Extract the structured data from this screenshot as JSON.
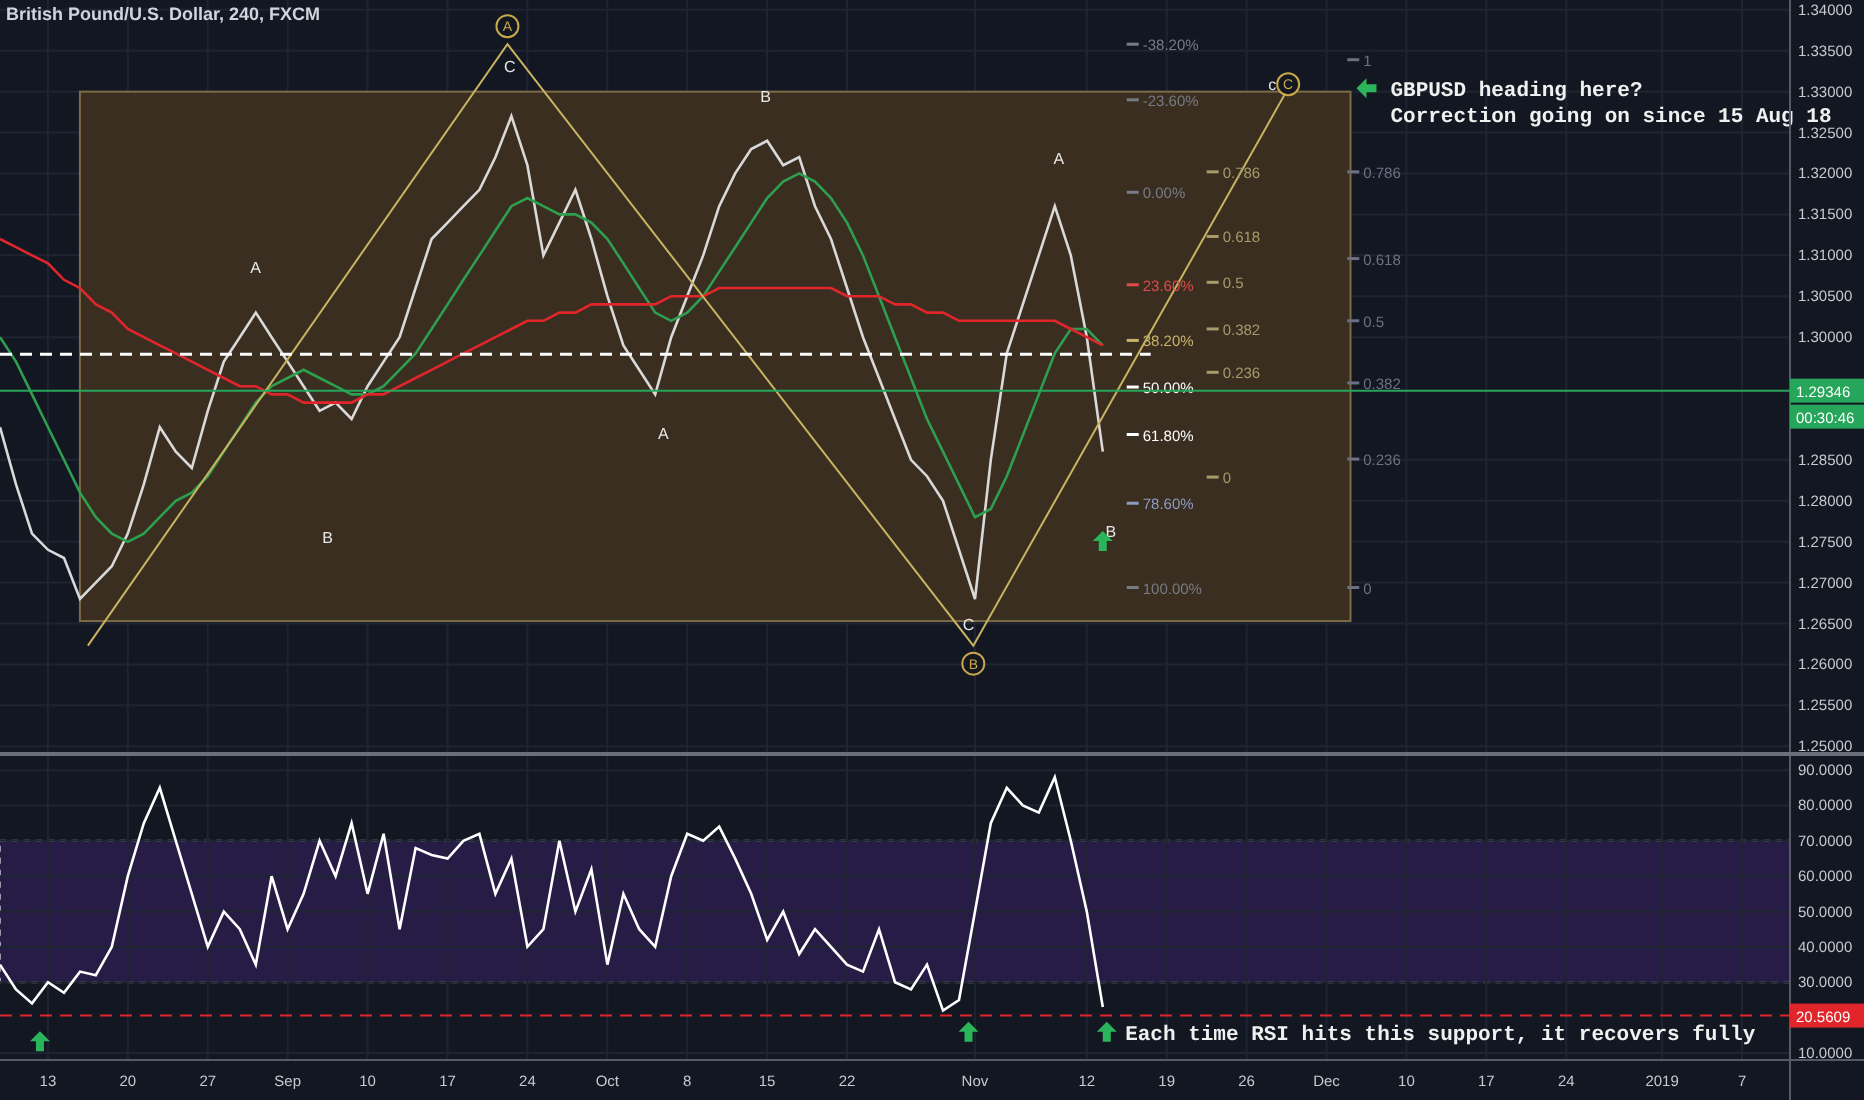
{
  "title": "British Pound/U.S. Dollar, 240, FXCM",
  "price_pane": {
    "chart_data": {
      "type": "line",
      "grid": true,
      "series": [
        {
          "color": "#d9d9d9",
          "values": [
            1.289,
            1.282,
            1.276,
            1.274,
            1.273,
            1.268,
            1.27,
            1.272,
            1.276,
            1.282,
            1.289,
            1.286,
            1.284,
            1.291,
            1.297,
            1.3,
            1.303,
            1.3,
            1.297,
            1.294,
            1.291,
            1.292,
            1.29,
            1.294,
            1.297,
            1.3,
            1.306,
            1.312,
            1.314,
            1.316,
            1.318,
            1.322,
            1.327,
            1.321,
            1.31,
            1.314,
            1.318,
            1.312,
            1.305,
            1.299,
            1.296,
            1.293,
            1.3,
            1.305,
            1.31,
            1.316,
            1.32,
            1.323,
            1.324,
            1.321,
            1.322,
            1.316,
            1.312,
            1.306,
            1.3,
            1.295,
            1.29,
            1.285,
            1.283,
            1.28,
            1.274,
            1.268,
            1.285,
            1.298,
            1.304,
            1.31,
            1.316,
            1.31,
            1.3,
            1.286
          ]
        },
        {
          "color": "#2e9e4f",
          "values": [
            1.3,
            1.297,
            1.293,
            1.289,
            1.285,
            1.281,
            1.278,
            1.276,
            1.275,
            1.276,
            1.278,
            1.28,
            1.281,
            1.283,
            1.286,
            1.289,
            1.292,
            1.294,
            1.295,
            1.296,
            1.295,
            1.294,
            1.293,
            1.293,
            1.294,
            1.296,
            1.298,
            1.301,
            1.304,
            1.307,
            1.31,
            1.313,
            1.316,
            1.317,
            1.316,
            1.315,
            1.315,
            1.314,
            1.312,
            1.309,
            1.306,
            1.303,
            1.302,
            1.303,
            1.305,
            1.308,
            1.311,
            1.314,
            1.317,
            1.319,
            1.32,
            1.319,
            1.317,
            1.314,
            1.31,
            1.305,
            1.3,
            1.295,
            1.29,
            1.286,
            1.282,
            1.278,
            1.279,
            1.283,
            1.288,
            1.293,
            1.298,
            1.301,
            1.301,
            1.299
          ]
        },
        {
          "color": "#e0262b",
          "values": [
            1.312,
            1.311,
            1.31,
            1.309,
            1.307,
            1.306,
            1.304,
            1.303,
            1.301,
            1.3,
            1.299,
            1.298,
            1.297,
            1.296,
            1.295,
            1.294,
            1.294,
            1.293,
            1.293,
            1.292,
            1.292,
            1.292,
            1.292,
            1.293,
            1.293,
            1.294,
            1.295,
            1.296,
            1.297,
            1.298,
            1.299,
            1.3,
            1.301,
            1.302,
            1.302,
            1.303,
            1.303,
            1.304,
            1.304,
            1.304,
            1.304,
            1.304,
            1.305,
            1.305,
            1.305,
            1.306,
            1.306,
            1.306,
            1.306,
            1.306,
            1.306,
            1.306,
            1.306,
            1.305,
            1.305,
            1.305,
            1.304,
            1.304,
            1.303,
            1.303,
            1.302,
            1.302,
            1.302,
            1.302,
            1.302,
            1.302,
            1.302,
            1.301,
            1.3,
            1.299
          ]
        }
      ],
      "yticks": [
        {
          "value": 1.34,
          "label": "1.34000"
        },
        {
          "value": 1.335,
          "label": "1.33500"
        },
        {
          "value": 1.33,
          "label": "1.33000"
        },
        {
          "value": 1.325,
          "label": "1.32500"
        },
        {
          "value": 1.32,
          "label": "1.32000"
        },
        {
          "value": 1.315,
          "label": "1.31500"
        },
        {
          "value": 1.31,
          "label": "1.31000"
        },
        {
          "value": 1.305,
          "label": "1.30500"
        },
        {
          "value": 1.3,
          "label": "1.30000"
        },
        {
          "value": 1.285,
          "label": "1.28500"
        },
        {
          "value": 1.28,
          "label": "1.28000"
        },
        {
          "value": 1.275,
          "label": "1.27500"
        },
        {
          "value": 1.27,
          "label": "1.27000"
        },
        {
          "value": 1.265,
          "label": "1.26500"
        },
        {
          "value": 1.26,
          "label": "1.26000"
        },
        {
          "value": 1.255,
          "label": "1.25500"
        },
        {
          "value": 1.25,
          "label": "1.25000"
        }
      ],
      "ylim": [
        1.2493,
        1.3412
      ]
    },
    "last_price": "1.29346",
    "countdown": "00:30:46",
    "wave_labels": [
      {
        "text": "A",
        "circled": true
      },
      {
        "text": "C",
        "circled": false
      },
      {
        "text": "B",
        "circled": false
      },
      {
        "text": "A",
        "circled": false
      },
      {
        "text": "B",
        "circled": false
      },
      {
        "text": "A",
        "circled": false
      },
      {
        "text": "A",
        "circled": false
      },
      {
        "text": "B",
        "circled": false
      },
      {
        "text": "C",
        "circled": false
      },
      {
        "text": "B",
        "circled": true
      },
      {
        "text": "c",
        "circled": false
      },
      {
        "text": "C",
        "circled": true
      }
    ],
    "fib_labels": [
      {
        "text": "-38.20%",
        "color": "#787b86"
      },
      {
        "text": "-23.60%",
        "color": "#787b86"
      },
      {
        "text": "0.00%",
        "color": "#787b86"
      },
      {
        "text": "23.60%",
        "color": "#e04b4b"
      },
      {
        "text": "38.20%",
        "color": "#c8b56a"
      },
      {
        "text": "50.00%",
        "color": "#ffffff"
      },
      {
        "text": "61.80%",
        "color": "#ffffff"
      },
      {
        "text": "78.60%",
        "color": "#8b9bc4"
      },
      {
        "text": "100.00%",
        "color": "#787b86"
      },
      {
        "text": "0.786",
        "color": "#a89a6a"
      },
      {
        "text": "0.618",
        "color": "#a89a6a"
      },
      {
        "text": "0.5",
        "color": "#a89a6a"
      },
      {
        "text": "0.382",
        "color": "#a89a6a"
      },
      {
        "text": "0.236",
        "color": "#a89a6a"
      },
      {
        "text": "0",
        "color": "#a89a6a"
      },
      {
        "text": "1",
        "color": "#6d7080"
      },
      {
        "text": "0.786",
        "color": "#6d7080"
      },
      {
        "text": "0.618",
        "color": "#6d7080"
      },
      {
        "text": "0.5",
        "color": "#6d7080"
      },
      {
        "text": "0.382",
        "color": "#6d7080"
      },
      {
        "text": "0.236",
        "color": "#6d7080"
      },
      {
        "text": "0",
        "color": "#6d7080"
      }
    ],
    "note": [
      "GBPUSD heading here?",
      "Correction going on since 15 Aug 18"
    ]
  },
  "rsi_pane": {
    "chart_data": {
      "type": "line",
      "grid": true,
      "series": [
        {
          "color": "#ffffff",
          "values": [
            35,
            28,
            24,
            30,
            27,
            33,
            32,
            40,
            60,
            75,
            85,
            70,
            55,
            40,
            50,
            45,
            35,
            60,
            45,
            55,
            70,
            60,
            75,
            55,
            72,
            45,
            68,
            66,
            65,
            70,
            72,
            55,
            65,
            40,
            45,
            70,
            50,
            62,
            35,
            55,
            45,
            40,
            60,
            72,
            70,
            74,
            65,
            55,
            42,
            50,
            38,
            45,
            40,
            35,
            33,
            45,
            30,
            28,
            35,
            22,
            25,
            50,
            75,
            85,
            80,
            78,
            88,
            70,
            50,
            23
          ]
        }
      ],
      "yticks": [
        {
          "value": 90,
          "label": "90.0000"
        },
        {
          "value": 80,
          "label": "80.0000"
        },
        {
          "value": 70,
          "label": "70.0000"
        },
        {
          "value": 60,
          "label": "60.0000"
        },
        {
          "value": 50,
          "label": "50.0000"
        },
        {
          "value": 40,
          "label": "40.0000"
        },
        {
          "value": 30,
          "label": "30.0000"
        },
        {
          "value": 10,
          "label": "10.0000"
        }
      ],
      "ylim": [
        8,
        94
      ]
    },
    "support_level": "20.5609",
    "note": "Each time RSI hits this support, it recovers fully"
  },
  "time_axis": [
    "13",
    "20",
    "27",
    "Sep",
    "10",
    "17",
    "24",
    "Oct",
    "8",
    "15",
    "22",
    "Nov",
    "12",
    "19",
    "26",
    "Dec",
    "10",
    "17",
    "24",
    "2019",
    "7"
  ]
}
